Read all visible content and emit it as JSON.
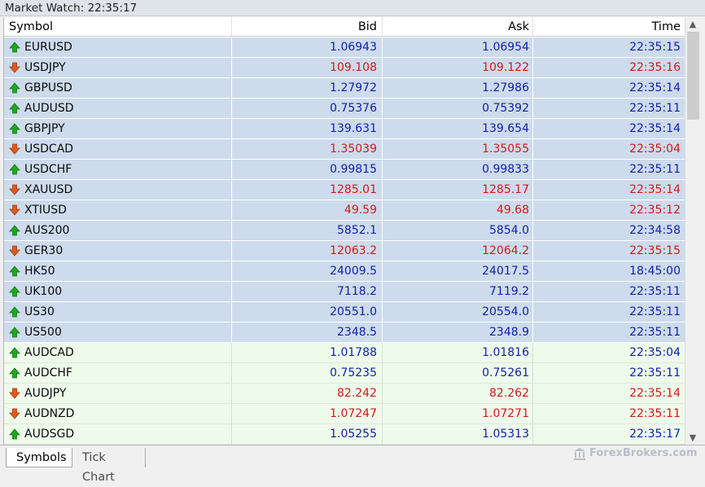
{
  "window": {
    "title": "Market Watch: 22:35:17"
  },
  "columns": {
    "symbol": "Symbol",
    "bid": "Bid",
    "ask": "Ask",
    "time": "Time"
  },
  "colors": {
    "up_text": "#1222a8",
    "down_text": "#d11a1a",
    "up_arrow": "#1ea81e",
    "down_arrow": "#e05a1a",
    "row_blue": "#cddbec",
    "row_green": "#eefbea"
  },
  "rows": [
    {
      "symbol": "EURUSD",
      "bid": "1.06943",
      "ask": "1.06954",
      "time": "22:35:15",
      "direction": "up",
      "group": "blue"
    },
    {
      "symbol": "USDJPY",
      "bid": "109.108",
      "ask": "109.122",
      "time": "22:35:16",
      "direction": "down",
      "group": "blue"
    },
    {
      "symbol": "GBPUSD",
      "bid": "1.27972",
      "ask": "1.27986",
      "time": "22:35:14",
      "direction": "up",
      "group": "blue"
    },
    {
      "symbol": "AUDUSD",
      "bid": "0.75376",
      "ask": "0.75392",
      "time": "22:35:11",
      "direction": "up",
      "group": "blue"
    },
    {
      "symbol": "GBPJPY",
      "bid": "139.631",
      "ask": "139.654",
      "time": "22:35:14",
      "direction": "up",
      "group": "blue"
    },
    {
      "symbol": "USDCAD",
      "bid": "1.35039",
      "ask": "1.35055",
      "time": "22:35:04",
      "direction": "down",
      "group": "blue"
    },
    {
      "symbol": "USDCHF",
      "bid": "0.99815",
      "ask": "0.99833",
      "time": "22:35:11",
      "direction": "up",
      "group": "blue"
    },
    {
      "symbol": "XAUUSD",
      "bid": "1285.01",
      "ask": "1285.17",
      "time": "22:35:14",
      "direction": "down",
      "group": "blue"
    },
    {
      "symbol": "XTIUSD",
      "bid": "49.59",
      "ask": "49.68",
      "time": "22:35:12",
      "direction": "down",
      "group": "blue"
    },
    {
      "symbol": "AUS200",
      "bid": "5852.1",
      "ask": "5854.0",
      "time": "22:34:58",
      "direction": "up",
      "group": "blue"
    },
    {
      "symbol": "GER30",
      "bid": "12063.2",
      "ask": "12064.2",
      "time": "22:35:15",
      "direction": "down",
      "group": "blue"
    },
    {
      "symbol": "HK50",
      "bid": "24009.5",
      "ask": "24017.5",
      "time": "18:45:00",
      "direction": "up",
      "group": "blue"
    },
    {
      "symbol": "UK100",
      "bid": "7118.2",
      "ask": "7119.2",
      "time": "22:35:11",
      "direction": "up",
      "group": "blue"
    },
    {
      "symbol": "US30",
      "bid": "20551.0",
      "ask": "20554.0",
      "time": "22:35:11",
      "direction": "up",
      "group": "blue"
    },
    {
      "symbol": "US500",
      "bid": "2348.5",
      "ask": "2348.9",
      "time": "22:35:11",
      "direction": "up",
      "group": "blue"
    },
    {
      "symbol": "AUDCAD",
      "bid": "1.01788",
      "ask": "1.01816",
      "time": "22:35:04",
      "direction": "up",
      "group": "green"
    },
    {
      "symbol": "AUDCHF",
      "bid": "0.75235",
      "ask": "0.75261",
      "time": "22:35:11",
      "direction": "up",
      "group": "green"
    },
    {
      "symbol": "AUDJPY",
      "bid": "82.242",
      "ask": "82.262",
      "time": "22:35:14",
      "direction": "down",
      "group": "green"
    },
    {
      "symbol": "AUDNZD",
      "bid": "1.07247",
      "ask": "1.07271",
      "time": "22:35:11",
      "direction": "down",
      "group": "green"
    },
    {
      "symbol": "AUDSGD",
      "bid": "1.05255",
      "ask": "1.05313",
      "time": "22:35:17",
      "direction": "up",
      "group": "green"
    }
  ],
  "tabs": [
    {
      "label": "Symbols",
      "active": true
    },
    {
      "label": "Tick Chart",
      "active": false
    }
  ],
  "scrollbar": {
    "up_icon": "chevron-up-icon",
    "down_icon": "chevron-down-icon"
  },
  "watermark": {
    "text": "ForexBrokers.com",
    "icon": "building-icon"
  }
}
